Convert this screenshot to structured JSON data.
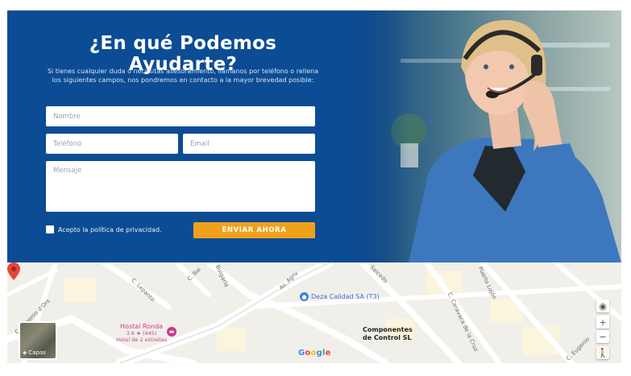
{
  "form": {
    "heading": "¿En qué Podemos Ayudarte?",
    "intro": "Si tienes cualquier duda o necesitas asesoramiento, llámanos por teléfono o rellena los siguientes campos, nos pondremos en contacto a la mayor brevedad posible:",
    "name_placeholder": "Nombre",
    "phone_placeholder": "Teléfono",
    "email_placeholder": "Email",
    "message_placeholder": "Mensaje",
    "consent_label": "Acepto la política de privacidad.",
    "submit_label": "ENVIAR AHORA"
  },
  "map": {
    "streets": [
      "C. Eugenio d'Ors",
      "C. Lepanto",
      "C. Bai",
      "Bulgaria",
      "Av. Agru",
      "Salcedo",
      "C. Caravaca de la Cruz",
      "Puerto Lujón",
      "C. Eugenio"
    ],
    "poi_blue": "Deza Calidad SA (T3)",
    "hotel_name": "Hostal Ronda",
    "hotel_rating": "3.6 ★ (445)",
    "hotel_stars": "Hotel de 2 estrellas",
    "company_line1": "Componentes",
    "company_line2": "de Control SL",
    "layers_label": "Capas",
    "google": "Google",
    "zoom_in": "+",
    "zoom_out": "−",
    "locate_icon": "◉",
    "pegman_icon": "🚶",
    "layers_icon": "◈",
    "colors": {
      "accent": "#f0a11b",
      "brand": "#0b4c95",
      "pin": "#e2463c"
    }
  }
}
